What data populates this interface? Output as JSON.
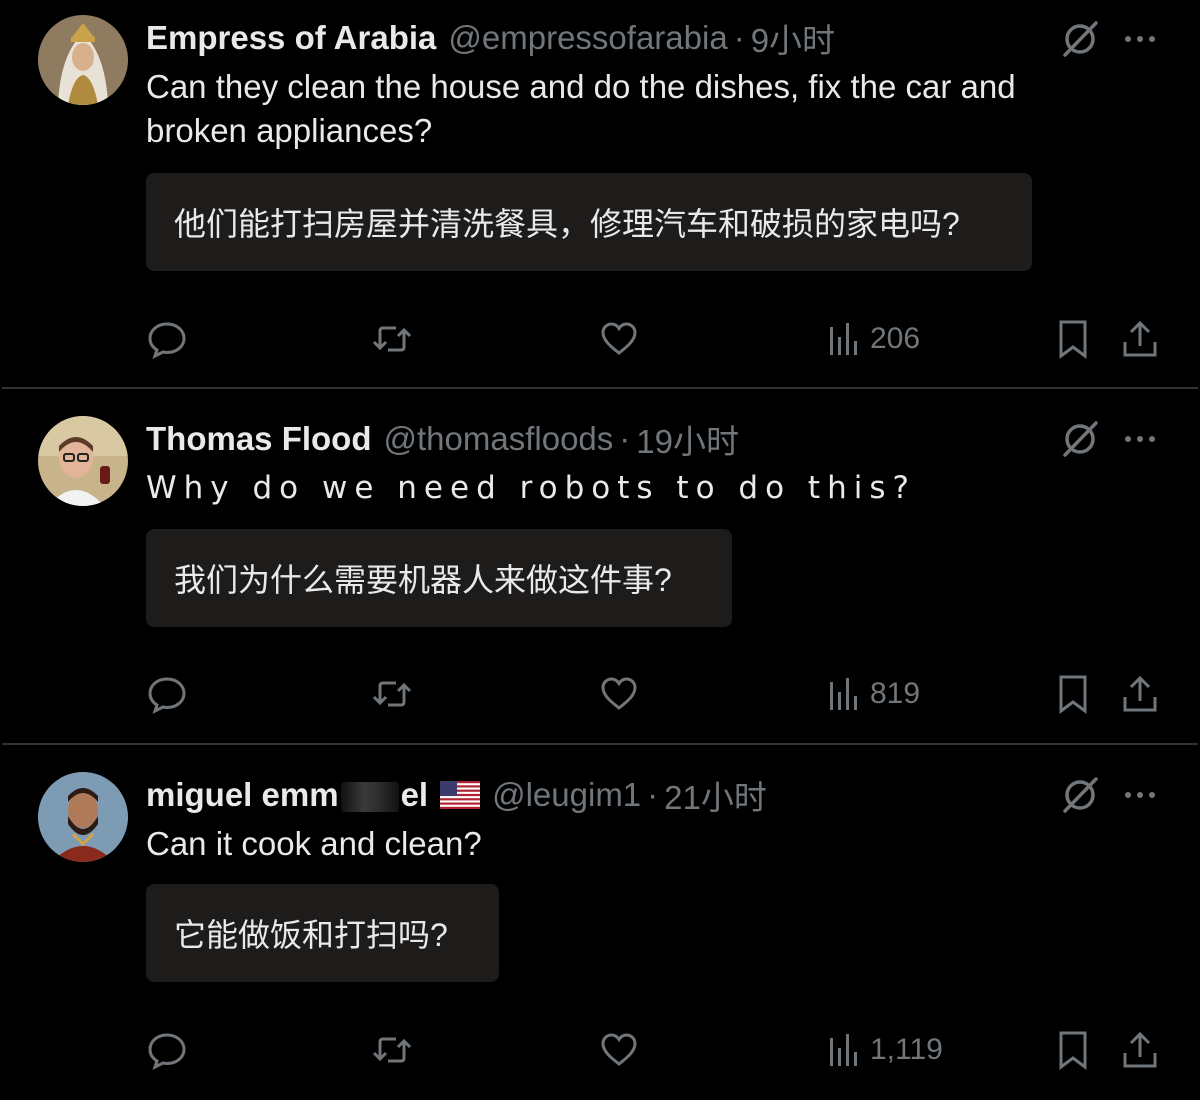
{
  "tweets": [
    {
      "display_name": "Empress of Arabia",
      "handle": "@empressofarabia",
      "separator": "·",
      "time": "9小时",
      "text_lines": [
        "Can they clean the house and do the dishes, fix the car and",
        "broken appliances?"
      ],
      "translation": "他们能打扫房屋并清洗餐具，修理汽车和破损的家电吗?",
      "views": "206",
      "avatar_icon": "avatar-woman-veil"
    },
    {
      "display_name": "Thomas Flood",
      "handle": "@thomasfloods",
      "separator": "·",
      "time": "19小时",
      "text_lines": [
        "Why do we need robots to do this?"
      ],
      "translation": "我们为什么需要机器人来做这件事?",
      "views": "819",
      "avatar_icon": "avatar-man-glasses"
    },
    {
      "display_name_part1": "miguel emm",
      "display_name_part2": "el",
      "display_name_flag": "us-flag-icon",
      "handle": "@leugim1",
      "separator": "·",
      "time": "21小时",
      "text_lines": [
        "Can it cook and clean?"
      ],
      "translation": "它能做饭和打扫吗?",
      "views": "1,119",
      "avatar_icon": "avatar-bearded-man"
    }
  ],
  "icons": {
    "reply": "reply-icon",
    "retweet": "retweet-icon",
    "like": "like-icon",
    "views": "views-icon",
    "bookmark": "bookmark-icon",
    "share": "share-icon",
    "grok": "grok-icon",
    "more": "more-icon"
  },
  "colors": {
    "background": "#000000",
    "text": "#e7e9ea",
    "muted": "#71767b",
    "translation_bg": "#1e1b1b",
    "divider": "#2f3336"
  }
}
